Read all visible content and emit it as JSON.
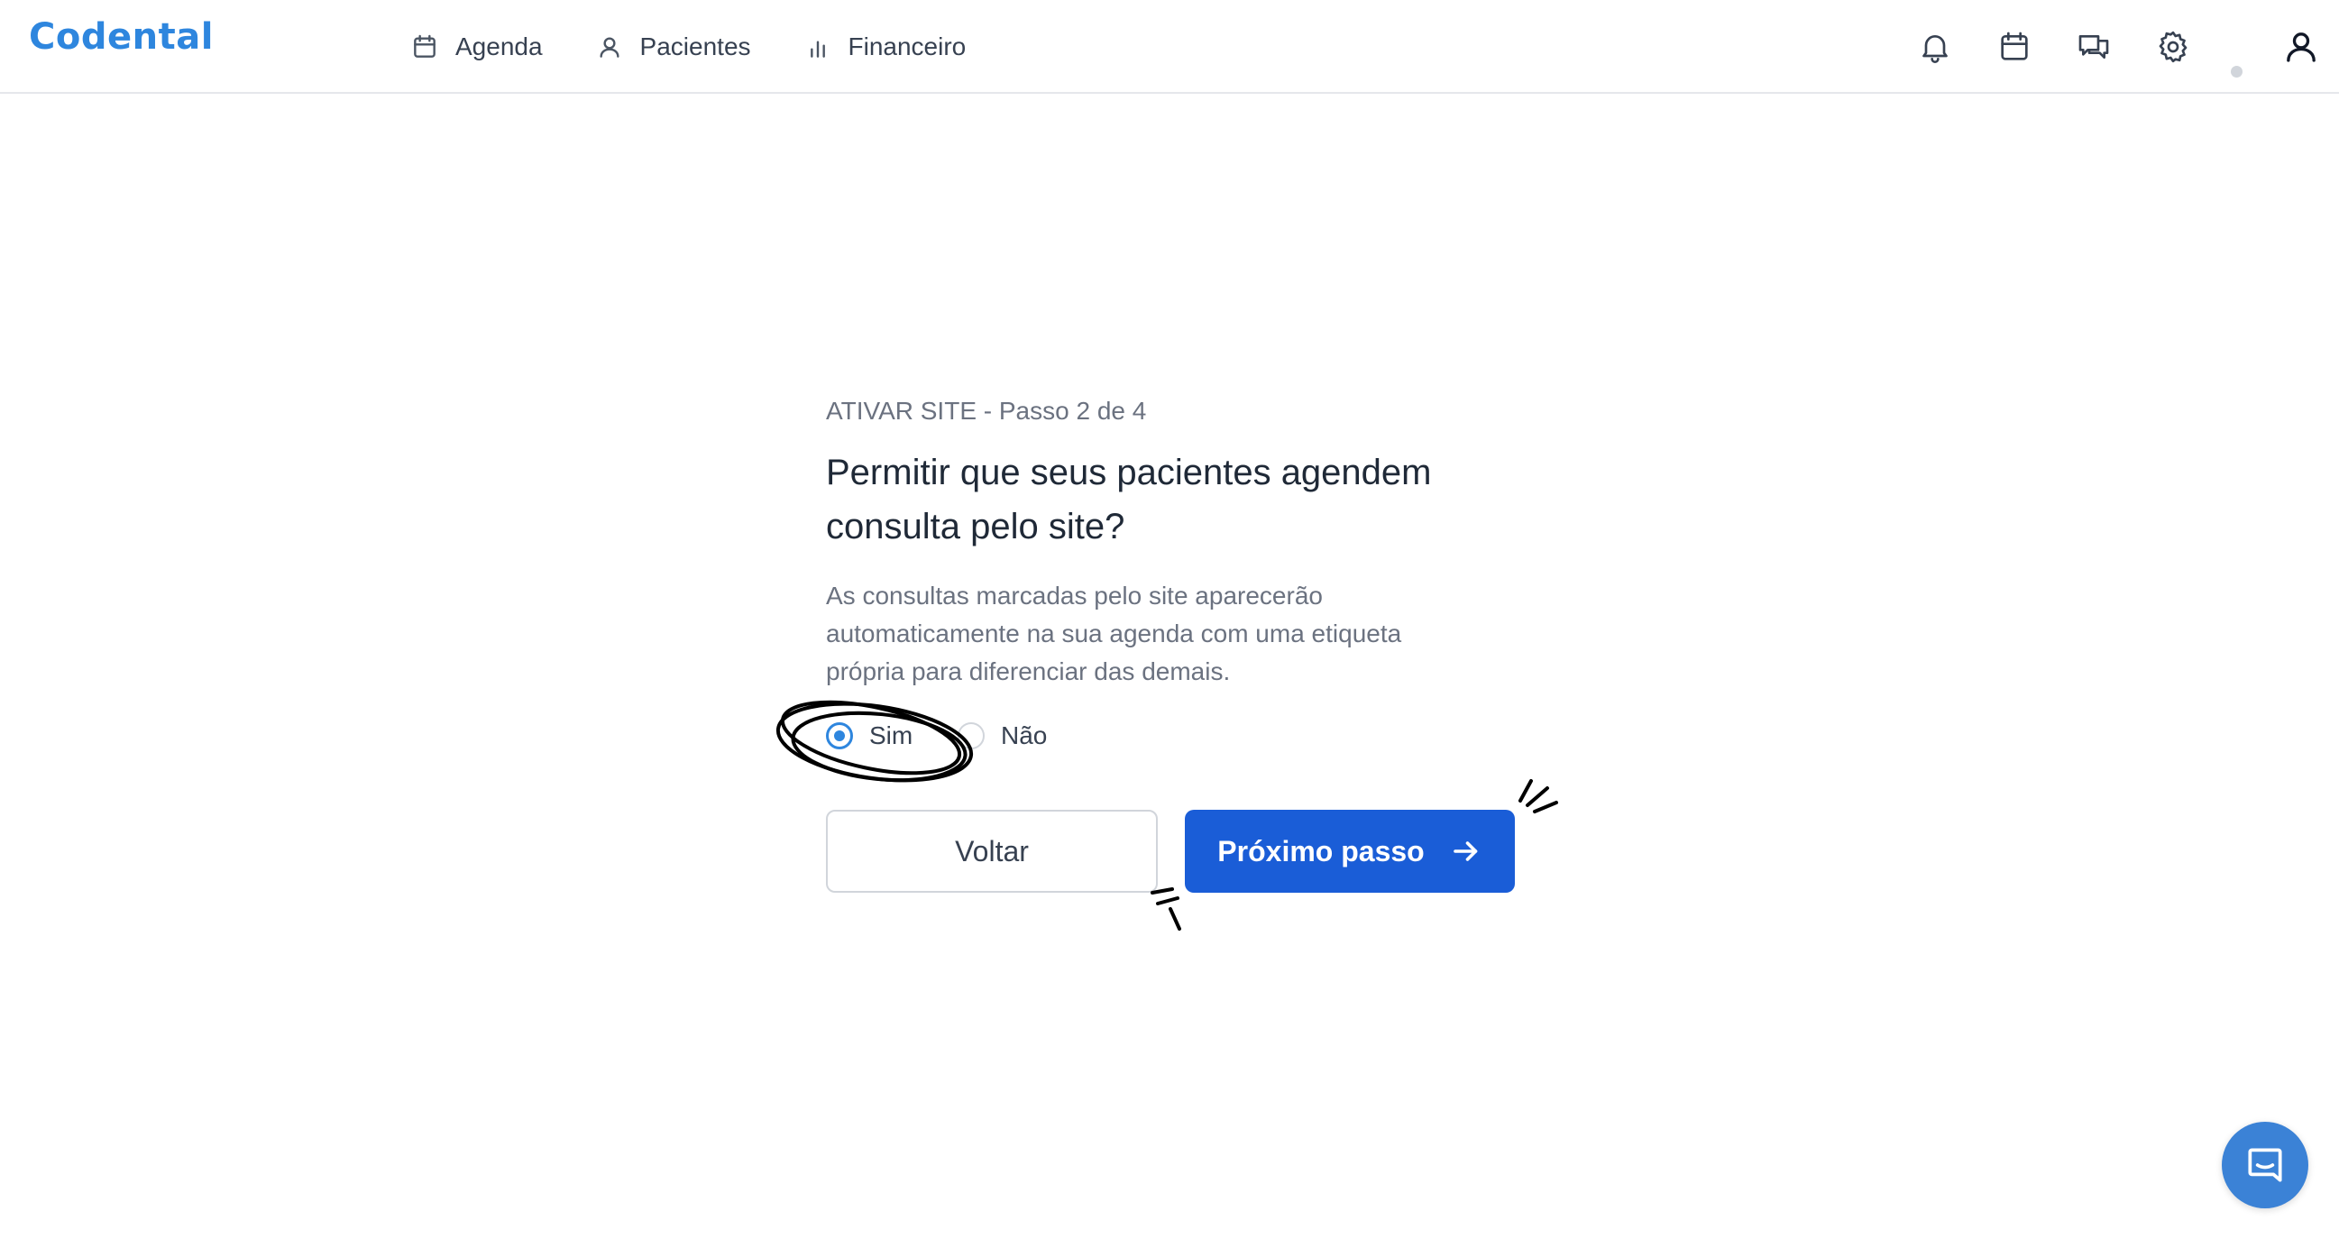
{
  "app": {
    "logo_text": "Codental",
    "brand_color": "#2e86de",
    "primary_button_color": "#1a5dd7"
  },
  "nav": {
    "items": [
      {
        "label": "Agenda",
        "icon": "calendar-icon"
      },
      {
        "label": "Pacientes",
        "icon": "user-icon"
      },
      {
        "label": "Financeiro",
        "icon": "bar-chart-icon"
      }
    ]
  },
  "header_icons": [
    "bell-icon",
    "calendar-icon",
    "chat-icon",
    "gear-icon",
    "status-dot",
    "profile-icon"
  ],
  "wizard": {
    "step_label": "ATIVAR SITE - Passo 2 de 4",
    "title": "Permitir que seus pacientes agendem consulta pelo site?",
    "description": "As consultas marcadas pelo site aparecerão automaticamente na sua agenda com uma etiqueta própria para diferenciar das demais.",
    "options": [
      {
        "label": "Sim",
        "selected": true
      },
      {
        "label": "Não",
        "selected": false
      }
    ],
    "back_label": "Voltar",
    "next_label": "Próximo passo"
  },
  "support": {
    "icon": "chat-bubble-icon"
  }
}
